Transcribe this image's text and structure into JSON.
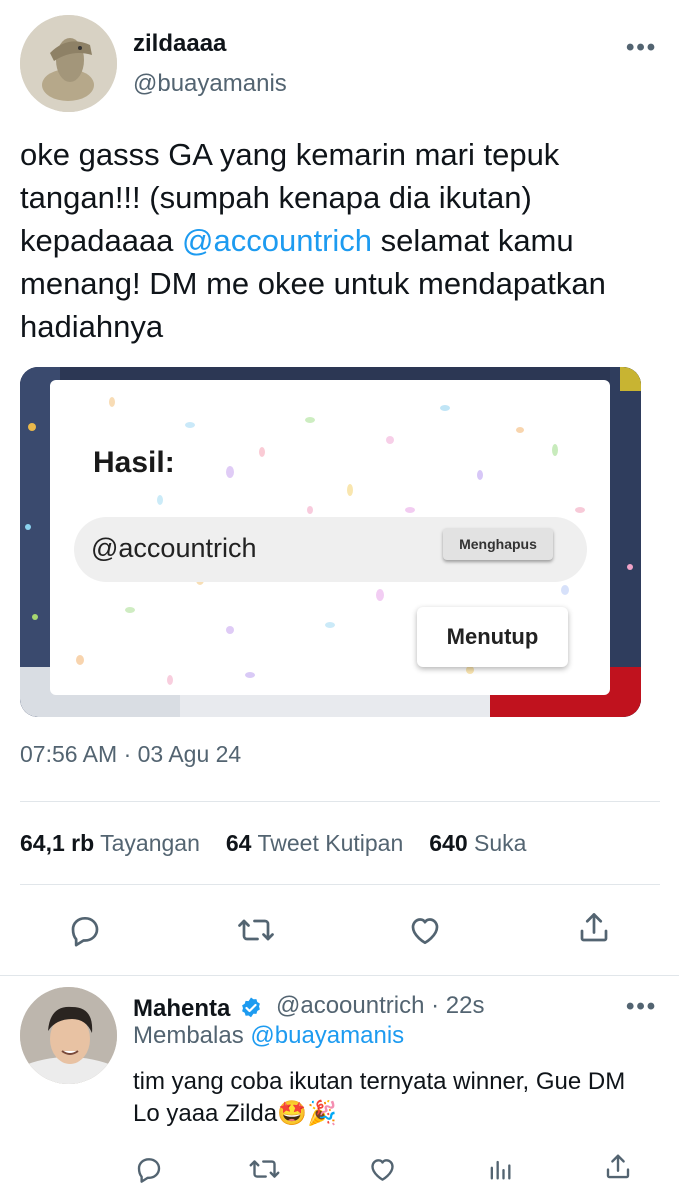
{
  "tweet": {
    "display_name": "zildaaaa",
    "handle": "@buayamanis",
    "text_before": "oke gasss GA yang kemarin mari tepuk tangan!!! (sumpah kenapa dia ikutan) kepadaaaa ",
    "mention": "@accountrich",
    "text_after": " selamat kamu menang! DM me okee untuk mendapatkan hadiahnya",
    "timestamp": "07:56 AM · 03 Agu 24",
    "more": "•••"
  },
  "media": {
    "title": "Hasil:",
    "result": "@accountrich",
    "delete_label": "Menghapus",
    "close_label": "Menutup"
  },
  "stats": {
    "views_count": "64,1 rb",
    "views_label": "Tayangan",
    "quotes_count": "64",
    "quotes_label": "Tweet Kutipan",
    "likes_count": "640",
    "likes_label": "Suka"
  },
  "reply": {
    "display_name": "Mahenta",
    "handle": "@acoountrich · 22s",
    "replying_prefix": "Membalas",
    "replying_to": "@buayamanis",
    "text": "tim yang coba ikutan ternyata winner, Gue DM Lo yaaa Zilda🤩🎉",
    "more": "•••"
  },
  "colors": {
    "accent": "#1d9bf0",
    "secondary_text": "#536471",
    "primary_text": "#0f1419"
  },
  "icons": [
    "reply-icon",
    "retweet-icon",
    "like-icon",
    "share-icon",
    "views-icon",
    "verified-badge-icon",
    "more-icon"
  ]
}
